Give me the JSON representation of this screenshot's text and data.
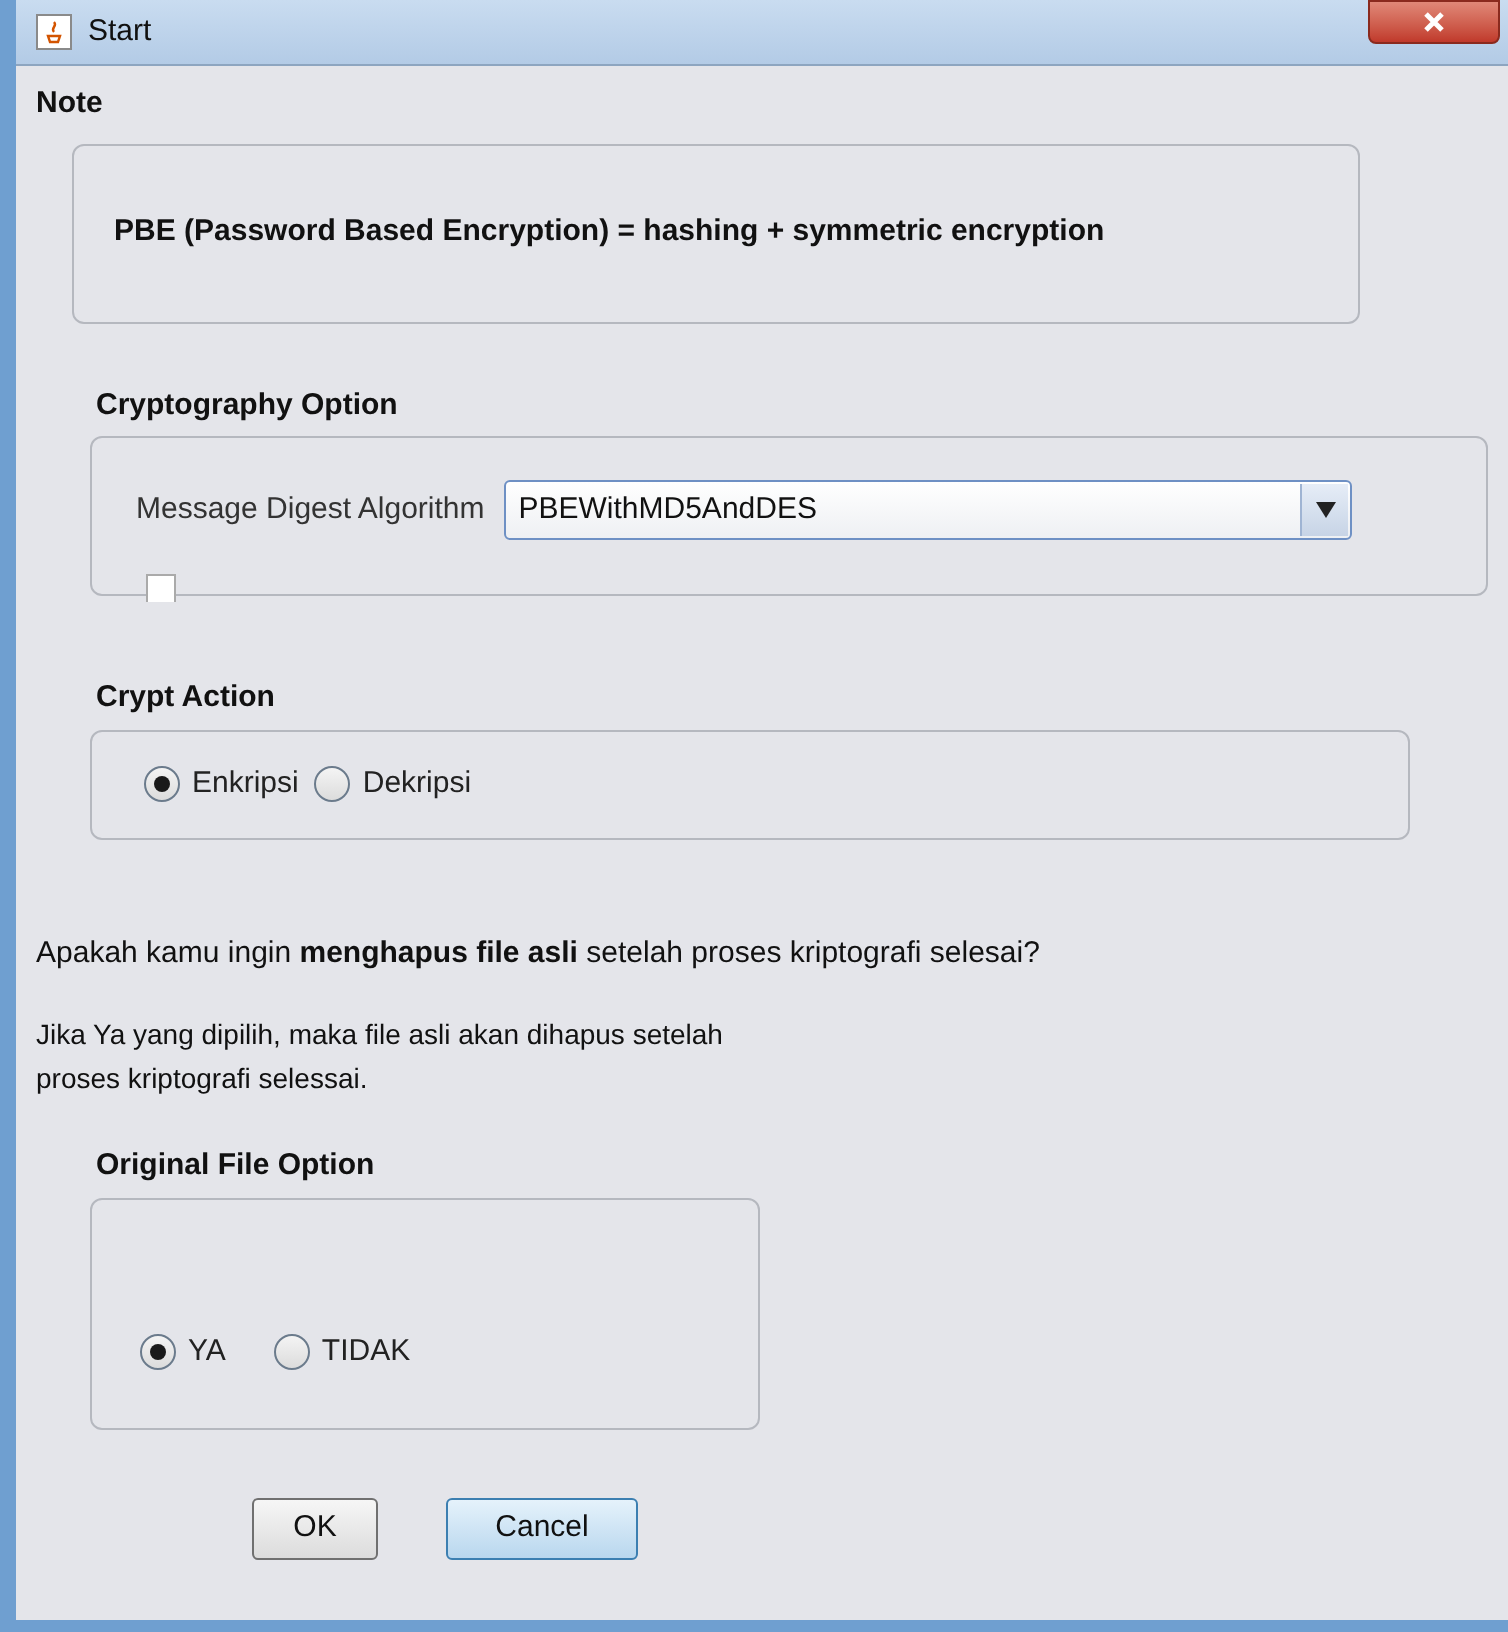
{
  "window": {
    "title": "Start"
  },
  "note": {
    "title": "Note",
    "text": "PBE (Password Based Encryption) = hashing + symmetric encryption"
  },
  "crypto_option": {
    "title": "Cryptography Option",
    "label": "Message Digest Algorithm",
    "value": "PBEWithMD5AndDES"
  },
  "crypt_action": {
    "title": "Crypt Action",
    "options": [
      {
        "label": "Enkripsi",
        "selected": true
      },
      {
        "label": "Dekripsi",
        "selected": false
      }
    ]
  },
  "question": "Apakah kamu ingin **menghapus file asli** setelah proses kriptografi selesai?",
  "info": [
    "Jika Ya yang dipilih, maka file asli akan dihapus setelah",
    "proses kriptografi selessai."
  ],
  "original_file_option": {
    "title": "Original File Option",
    "options": [
      {
        "label": "YA",
        "selected": true
      },
      {
        "label": "TIDAK",
        "selected": false
      }
    ]
  },
  "buttons": [
    {
      "label": "OK",
      "kind": "plain"
    },
    {
      "label": "Cancel",
      "kind": "focused"
    }
  ]
}
